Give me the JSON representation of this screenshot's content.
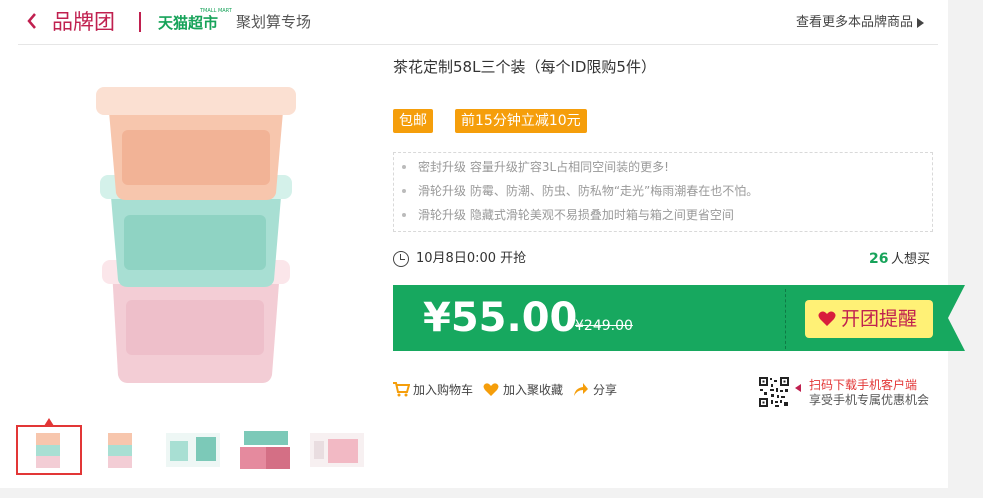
{
  "header": {
    "back_icon": "chevron-left-icon",
    "title": "品牌团",
    "tmall_logo": "天猫超市",
    "tmall_logo_en": "TMALL MART",
    "juhua_label": "聚划算专场",
    "more_label": "查看更多本品牌商品"
  },
  "product": {
    "title": "茶花定制58L三个装（每个ID限购5件）",
    "tags": [
      "包邮",
      "前15分钟立减10元"
    ],
    "features": [
      "密封升级 容量升级扩容3L占相同空间装的更多!",
      "滑轮升级 防霉、防潮、防虫、防私物“走光”梅雨潮春在也不怕。",
      "滑轮升级 隐藏式滑轮美观不易损叠加时箱与箱之间更省空间"
    ],
    "start_time": "10月8日0:00 开抢",
    "want_count": "26",
    "want_label": "人想买",
    "price": "¥55.00",
    "original_price": "¥249.00",
    "remind_label": "开团提醒"
  },
  "actions": {
    "cart_label": "加入购物车",
    "fav_label": "加入聚收藏",
    "share_label": "分享"
  },
  "qr": {
    "line1": "扫码下载手机客户端",
    "line2": "享受手机专属优惠机会"
  },
  "colors": {
    "brand": "#c0204f",
    "green": "#17a35a",
    "tag": "#f59e0b",
    "remind_bg": "#fff176"
  }
}
